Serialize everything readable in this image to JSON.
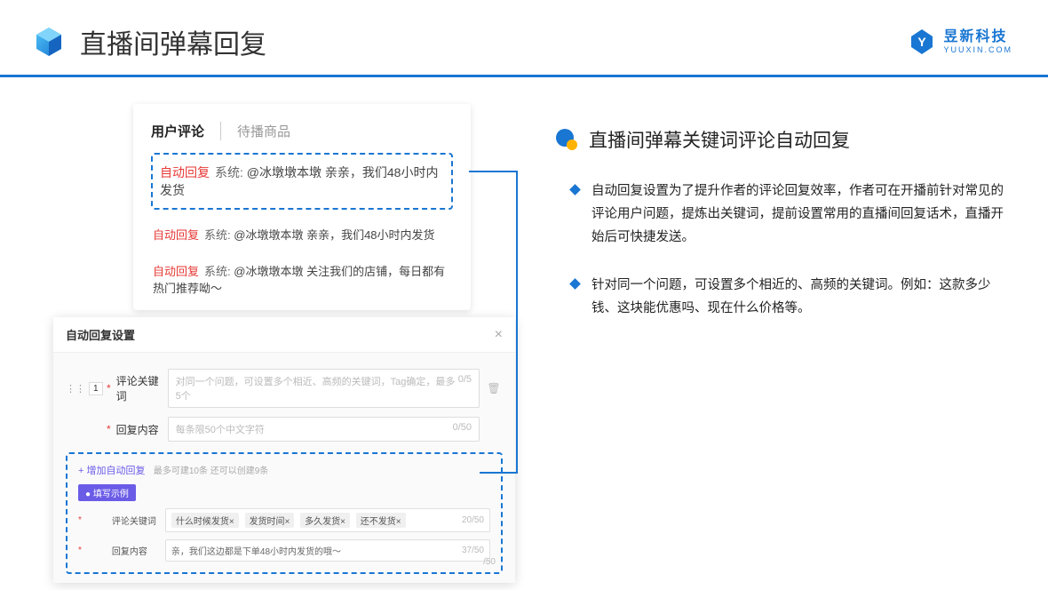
{
  "header": {
    "title": "直播间弹幕回复",
    "brand_name": "昱新科技",
    "brand_url": "YUUXIN.COM"
  },
  "comment_card": {
    "tab_active": "用户评论",
    "tab_inactive": "待播商品",
    "row1": {
      "tag": "自动回复",
      "sys": "系统:",
      "msg": "@冰墩墩本墩 亲亲，我们48小时内发货"
    },
    "row2": {
      "tag": "自动回复",
      "sys": "系统:",
      "msg": "@冰墩墩本墩 亲亲，我们48小时内发货"
    },
    "row3": {
      "tag": "自动回复",
      "sys": "系统:",
      "msg": "@冰墩墩本墩 关注我们的店铺，每日都有热门推荐呦～"
    }
  },
  "settings": {
    "title": "自动回复设置",
    "num": "1",
    "field1_label": "评论关键词",
    "field1_placeholder": "对同一个问题，可设置多个相近、高频的关键词，Tag确定，最多5个",
    "field1_counter": "0/5",
    "field2_label": "回复内容",
    "field2_placeholder": "每条限50个中文字符",
    "field2_counter": "0/50",
    "add_link": "+ 增加自动回复",
    "add_hint": "最多可建10条 还可以创建9条",
    "example_badge": "● 填写示例",
    "ex1_label": "评论关键词",
    "ex1_tags": [
      "什么时候发货×",
      "发货时间×",
      "多久发货×",
      "还不发货×"
    ],
    "ex1_counter": "20/50",
    "ex2_label": "回复内容",
    "ex2_text": "亲，我们这边都是下单48小时内发货的哦～",
    "ex2_counter": "37/50",
    "stray_counter": "/50"
  },
  "right": {
    "section_title": "直播间弹幕关键词评论自动回复",
    "bullet1": "自动回复设置为了提升作者的评论回复效率，作者可在开播前针对常见的评论用户问题，提炼出关键词，提前设置常用的直播间回复话术，直播开始后可快捷发送。",
    "bullet2": "针对同一个问题，可设置多个相近的、高频的关键词。例如：这款多少钱、这块能优惠吗、现在什么价格等。"
  }
}
